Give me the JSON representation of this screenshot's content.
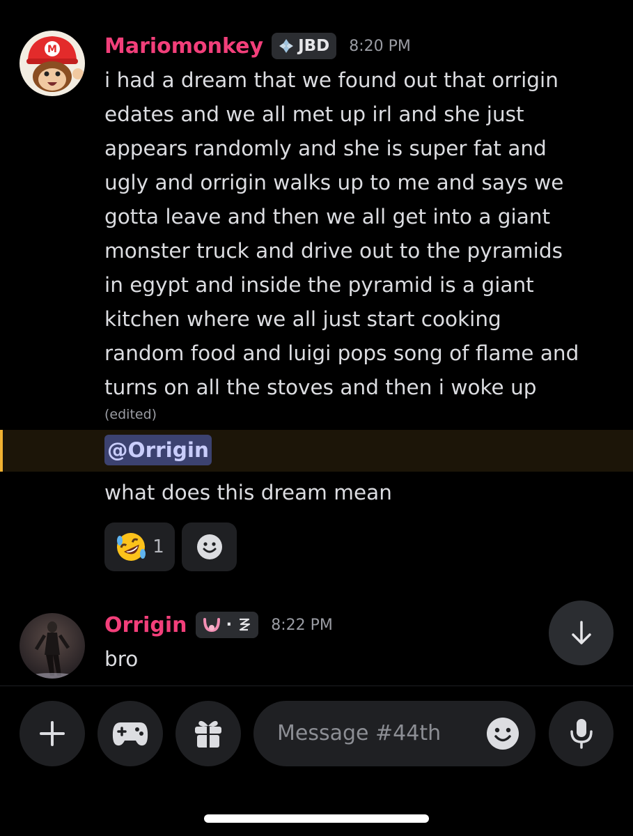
{
  "messages": [
    {
      "username": "Mariomonkey",
      "tag": "JBD",
      "time": "8:20 PM",
      "lines": [
        "i had a dream that we found out that orrigin",
        "edates and we all met up irl and she just",
        "appears randomly and she is super fat and",
        "ugly and orrigin walks up to me and says we",
        "gotta leave and then we all get into a giant",
        "monster truck and drive out to the pyramids",
        "in egypt and inside the pyramid is a giant",
        "kitchen where we all just start cooking",
        "random food and luigi pops song of flame and",
        "turns on all the stoves and then i woke up"
      ],
      "edited": "(edited)",
      "mention": "@Orrigin",
      "followup": "what does this dream mean",
      "reaction": {
        "emoji": "rolling-on-floor-laughing",
        "count": "1"
      }
    },
    {
      "username": "Orrigin",
      "tag_text": "·",
      "time": "8:22 PM",
      "text": "bro"
    }
  ],
  "composer": {
    "placeholder": "Message #44th"
  },
  "colors": {
    "username": "#f23f7a",
    "mention_bg": "#3c4270",
    "highlight_bar": "#f0b132"
  }
}
